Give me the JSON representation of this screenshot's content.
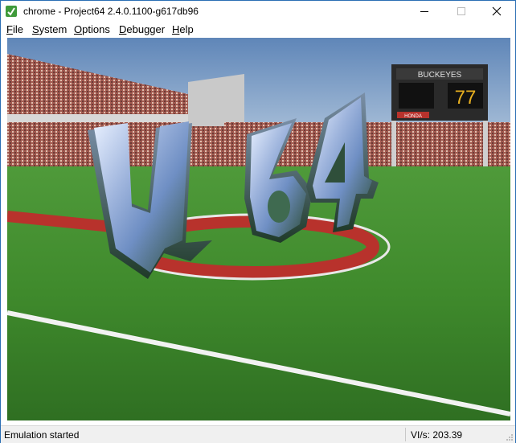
{
  "window": {
    "title": "chrome - Project64 2.4.0.1100-g617db96",
    "app_icon": "project64-icon"
  },
  "menu": {
    "items": [
      {
        "label": "File",
        "accel": "F",
        "rest": "ile"
      },
      {
        "label": "System",
        "accel": "S",
        "rest": "ystem"
      },
      {
        "label": "Options",
        "accel": "O",
        "rest": "ptions"
      },
      {
        "label": "Debugger",
        "accel": "D",
        "rest": "ebugger"
      },
      {
        "label": "Help",
        "accel": "H",
        "rest": "elp"
      }
    ]
  },
  "viewport": {
    "logo_text": "u64",
    "scoreboard_text": "BUCKEYES",
    "sponsor_text": "HONDA",
    "accent_red": "#b8322c",
    "grass_green": "#3f8a2c"
  },
  "status": {
    "left": "Emulation started",
    "right": "VI/s: 203.39"
  }
}
